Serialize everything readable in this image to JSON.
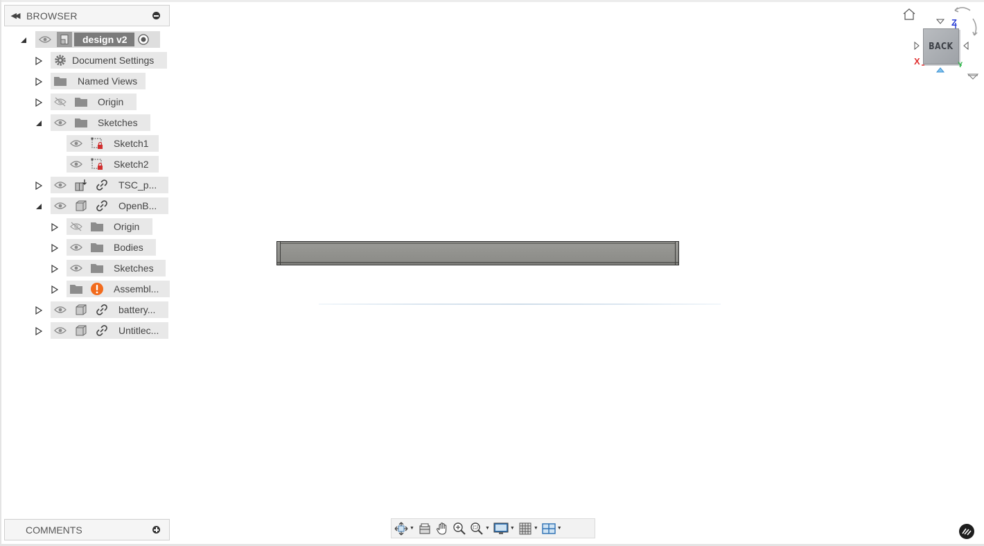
{
  "browser": {
    "title": "BROWSER",
    "root": {
      "label": "design v2"
    },
    "items": [
      {
        "label": "Document Settings"
      },
      {
        "label": "Named Views"
      },
      {
        "label": "Origin"
      },
      {
        "label": "Sketches"
      },
      {
        "label": "Sketch1"
      },
      {
        "label": "Sketch2"
      },
      {
        "label": "TSC_p..."
      },
      {
        "label": "OpenB..."
      },
      {
        "label": "Origin"
      },
      {
        "label": "Bodies"
      },
      {
        "label": "Sketches"
      },
      {
        "label": "Assembl..."
      },
      {
        "label": "battery..."
      },
      {
        "label": "Untitlec..."
      }
    ]
  },
  "comments": {
    "title": "COMMENTS"
  },
  "viewcube": {
    "face": "BACK",
    "axis_z": "Z",
    "axis_x": "X",
    "axis_y": "Y"
  },
  "icons": {
    "collapse": "double-chevron-left-icon",
    "eye": "eye-icon",
    "eye_hidden": "eye-hidden-icon",
    "folder": "folder-icon",
    "gear": "gear-icon",
    "link": "link-icon",
    "component": "component-icon",
    "sketch": "sketch-icon",
    "warning": "warning-icon"
  },
  "colors": {
    "warning": "#f26b1d",
    "axis_x": "#e03030",
    "axis_y": "#2fb54a",
    "axis_z": "#2b3fd6"
  }
}
